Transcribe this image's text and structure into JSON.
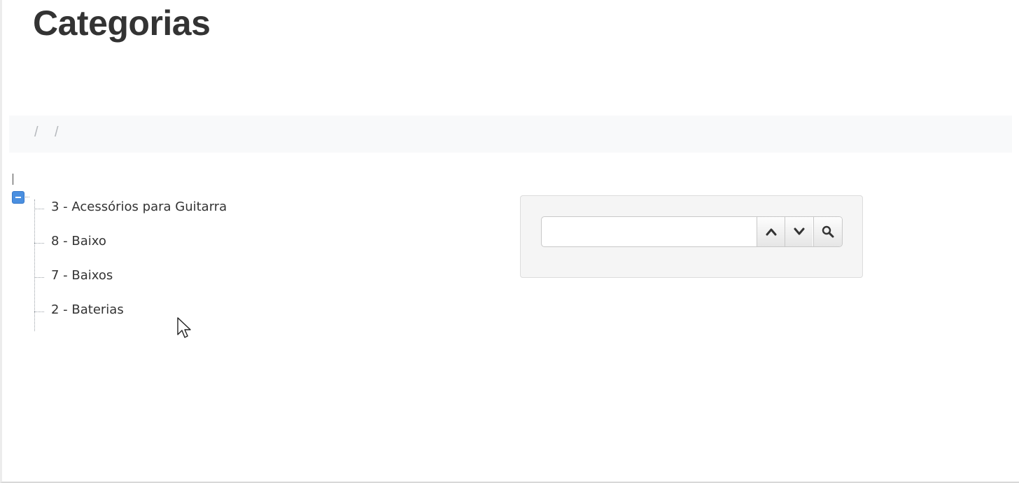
{
  "header": {
    "title": "Categorias"
  },
  "breadcrumb": {
    "separators": [
      "/",
      "/"
    ]
  },
  "tree": {
    "expanded": true,
    "items": [
      {
        "label": "3 - Acessórios para Guitarra"
      },
      {
        "label": "8 - Baixo"
      },
      {
        "label": "7 - Baixos"
      },
      {
        "label": "2 - Baterias"
      }
    ]
  },
  "search": {
    "value": "",
    "placeholder": "",
    "buttons": {
      "prev_icon": "chevron-up-icon",
      "next_icon": "chevron-down-icon",
      "search_icon": "search-icon"
    }
  },
  "colors": {
    "title": "#333333",
    "toggle": "#4a8fe0",
    "breadcrumb_bg": "#f8f9fa",
    "panel_bg": "#f5f5f5"
  }
}
